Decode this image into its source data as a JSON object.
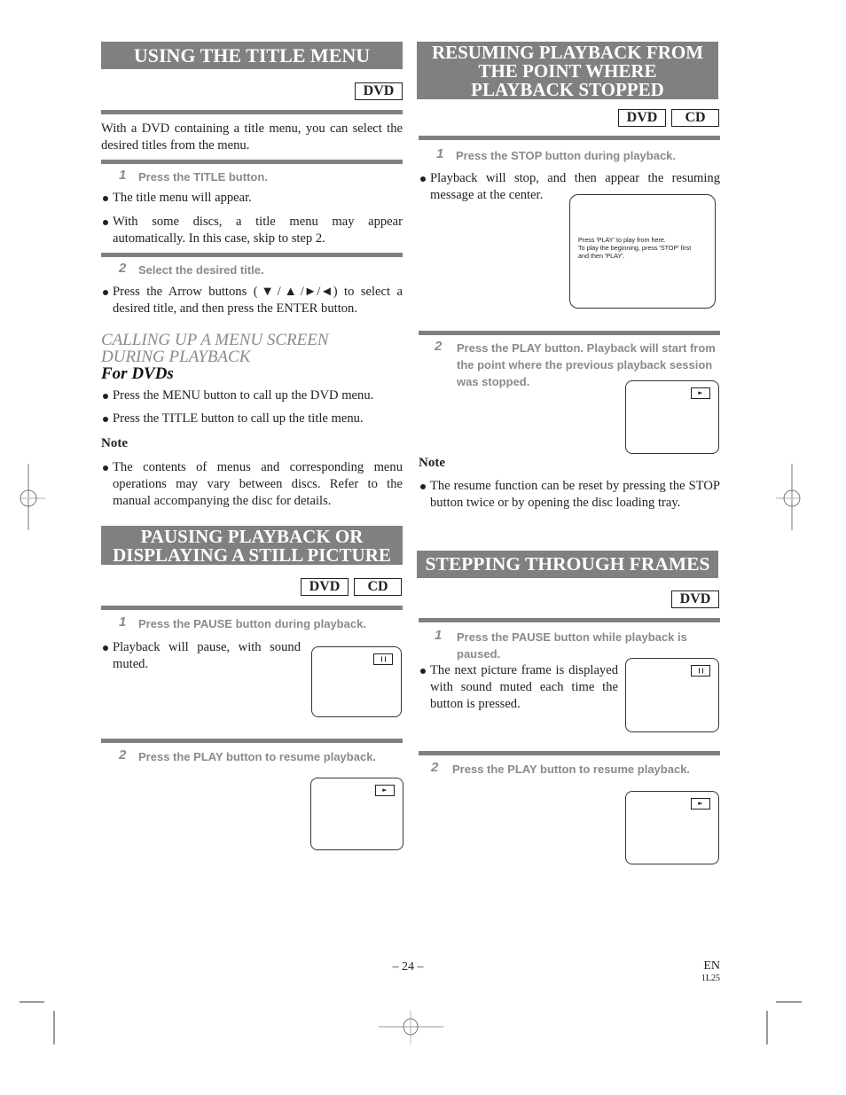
{
  "left": {
    "title_menu": {
      "title": "USING THE TITLE MENU",
      "badges": [
        "DVD"
      ],
      "intro": "With a DVD containing a title menu, you can select the desired titles from the menu.",
      "steps": [
        {
          "num": "1",
          "text": "Press the TITLE button.",
          "bullets": [
            "The title menu will appear.",
            "With some discs, a title menu may appear automatically. In this case, skip to step 2."
          ]
        },
        {
          "num": "2",
          "text": "Select the desired title.",
          "bullets": [
            "Press the Arrow buttons (▼/▲/►/◄) to select a desired title, and then press the ENTER button."
          ]
        }
      ],
      "sub_heading_line1": "CALLING UP A MENU SCREEN",
      "sub_heading_line2": "DURING PLAYBACK",
      "sub_sub_heading": "For DVDs",
      "sub_bullets": [
        "Press the MENU button to call up the DVD menu.",
        "Press the TITLE button to call up the title menu."
      ],
      "note_label": "Note",
      "note_bullets": [
        "The contents of menus and corresponding menu operations may vary between discs. Refer to the manual accompanying the disc for details."
      ]
    },
    "pausing": {
      "title_line1": "PAUSING PLAYBACK OR",
      "title_line2": "DISPLAYING A STILL PICTURE",
      "badges": [
        "DVD",
        "CD"
      ],
      "steps": [
        {
          "num": "1",
          "text": "Press the PAUSE button during playback.",
          "bullets": [
            "Playback will pause, with sound muted."
          ],
          "osd": "pause-icon",
          "osd_glyph": "❙❙"
        },
        {
          "num": "2",
          "text": "Press the PLAY button to resume playback.",
          "bullets": [],
          "osd": "play-icon",
          "osd_glyph": "►"
        }
      ]
    }
  },
  "right": {
    "resuming": {
      "title_line1": "RESUMING PLAYBACK FROM",
      "title_line2": "THE POINT WHERE",
      "title_line3": "PLAYBACK STOPPED",
      "badges": [
        "DVD",
        "CD"
      ],
      "steps": [
        {
          "num": "1",
          "text": "Press the STOP button during playback.",
          "bullets": [
            "Playback will stop, and then appear the resuming message at the center."
          ],
          "screen_message": [
            "Press 'PLAY' to play from here.",
            "To play the beginning, press 'STOP' first",
            "and then 'PLAY'."
          ]
        },
        {
          "num": "2",
          "text": "Press the PLAY button. Playback will start from the point where the previous playback session was stopped.",
          "osd": "play-icon",
          "osd_glyph": "►"
        }
      ],
      "note_label": "Note",
      "note_bullets": [
        "The resume function can be reset by pressing the STOP button twice or by opening the disc loading tray."
      ]
    },
    "stepping": {
      "title": "STEPPING THROUGH FRAMES",
      "badges": [
        "DVD"
      ],
      "steps": [
        {
          "num": "1",
          "text": "Press the PAUSE button while playback is paused.",
          "bullets": [
            "The next picture frame is displayed with sound muted each time the button is pressed."
          ],
          "osd": "pause-icon",
          "osd_glyph": "❙❙"
        },
        {
          "num": "2",
          "text": "Press the PLAY button to resume playback.",
          "osd": "play-icon",
          "osd_glyph": "►"
        }
      ]
    }
  },
  "footer": {
    "page_number": "– 24 –",
    "lang": "EN",
    "code": "1L25"
  }
}
